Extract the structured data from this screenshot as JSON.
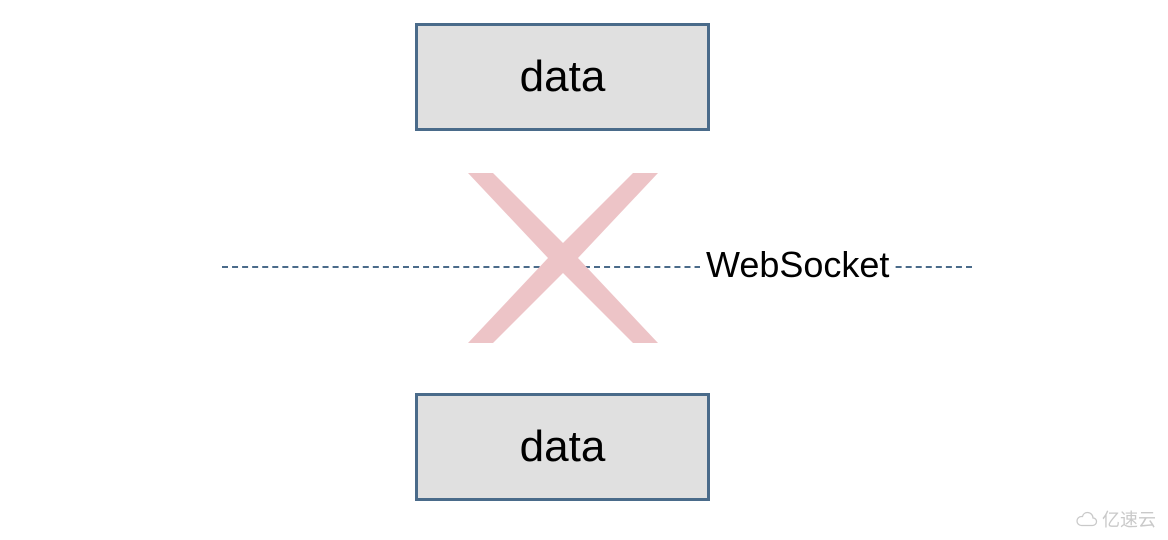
{
  "boxes": {
    "top": {
      "label": "data"
    },
    "bottom": {
      "label": "data"
    }
  },
  "connection": {
    "label": "WebSocket",
    "broken_symbol": "X"
  },
  "colors": {
    "box_border": "#4a6b8a",
    "box_fill": "#e0e0e0",
    "dash": "#4a6b8a",
    "x_fill": "#edc4c7"
  },
  "watermark": {
    "text": "亿速云"
  }
}
